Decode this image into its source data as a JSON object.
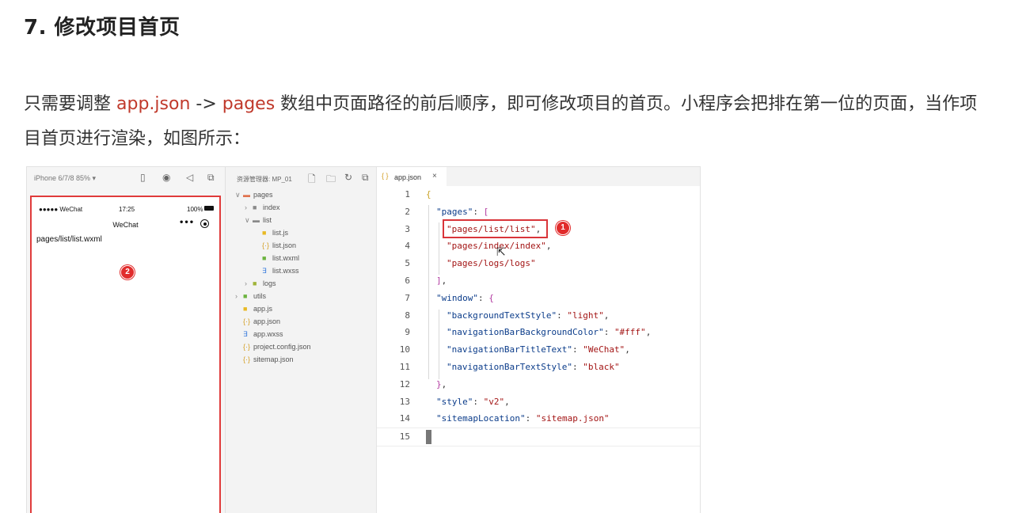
{
  "heading": "7. 修改项目首页",
  "paragraph": {
    "part1": "只需要调整 ",
    "code1": "app.json",
    "part2": " -> ",
    "code2": "pages",
    "part3": " 数组中页面路径的前后顺序，即可修改项目的首页。小程序会把排在第一位的页面，当作项目首页进行渲染，如图所示："
  },
  "colors": {
    "accent_red": "#c0392b",
    "marker_red": "#e12b2b"
  },
  "figure": {
    "simulator": {
      "device_label": "iPhone 6/7/8 85% ▾",
      "toolbar_icons": [
        "phone-icon",
        "record-icon",
        "sound-icon",
        "window-icon"
      ],
      "status_left": "●●●●● WeChat",
      "status_time": "17:25",
      "status_battery": "100%",
      "nav_title": "WeChat",
      "capsule_dots": "•••",
      "page_text": "pages/list/list.wxml",
      "marker": "2"
    },
    "explorer": {
      "header": "资源管理器: MP_01",
      "toolbar_icons": [
        "new-file-icon",
        "new-folder-icon",
        "refresh-icon",
        "collapse-icon"
      ],
      "tree": [
        {
          "label": "pages",
          "type": "folder-open",
          "chev": "∨",
          "level": 0
        },
        {
          "label": "index",
          "type": "folder",
          "chev": "›",
          "level": 1
        },
        {
          "label": "list",
          "type": "folder-open",
          "chev": "∨",
          "level": 1
        },
        {
          "label": "list.js",
          "type": "js",
          "chev": "",
          "level": 2
        },
        {
          "label": "list.json",
          "type": "json",
          "chev": "",
          "level": 2
        },
        {
          "label": "list.wxml",
          "type": "wxml",
          "chev": "",
          "level": 2
        },
        {
          "label": "list.wxss",
          "type": "wxss",
          "chev": "",
          "level": 2
        },
        {
          "label": "logs",
          "type": "folder",
          "chev": "›",
          "level": 1
        },
        {
          "label": "utils",
          "type": "folder",
          "chev": "›",
          "level": 0
        },
        {
          "label": "app.js",
          "type": "js",
          "chev": "",
          "level": 0
        },
        {
          "label": "app.json",
          "type": "json",
          "chev": "",
          "level": 0
        },
        {
          "label": "app.wxss",
          "type": "wxss",
          "chev": "",
          "level": 0
        },
        {
          "label": "project.config.json",
          "type": "json",
          "chev": "",
          "level": 0
        },
        {
          "label": "sitemap.json",
          "type": "json",
          "chev": "",
          "level": 0
        }
      ]
    },
    "editor": {
      "tab_label": "app.json",
      "tab_icon": "{ }",
      "tab_close": "×",
      "marker": "1",
      "lines": [
        {
          "n": "1",
          "indent": 0,
          "tokens": [
            {
              "t": "{",
              "c": "#c9a227"
            }
          ]
        },
        {
          "n": "2",
          "indent": 1,
          "tokens": [
            {
              "t": "\"pages\"",
              "c": "#0b3c8a"
            },
            {
              "t": ": ",
              "c": "#333333"
            },
            {
              "t": "[",
              "c": "#b23aa0"
            }
          ]
        },
        {
          "n": "3",
          "indent": 2,
          "tokens": [
            {
              "t": "\"pages/list/list\"",
              "c": "#a31515"
            },
            {
              "t": ",",
              "c": "#333333"
            }
          ]
        },
        {
          "n": "4",
          "indent": 2,
          "tokens": [
            {
              "t": "\"pages/index/index\"",
              "c": "#a31515"
            },
            {
              "t": ",",
              "c": "#333333"
            }
          ]
        },
        {
          "n": "5",
          "indent": 2,
          "tokens": [
            {
              "t": "\"pages/logs/logs\"",
              "c": "#a31515"
            }
          ]
        },
        {
          "n": "6",
          "indent": 1,
          "tokens": [
            {
              "t": "]",
              "c": "#b23aa0"
            },
            {
              "t": ",",
              "c": "#333333"
            }
          ]
        },
        {
          "n": "7",
          "indent": 1,
          "tokens": [
            {
              "t": "\"window\"",
              "c": "#0b3c8a"
            },
            {
              "t": ": ",
              "c": "#333333"
            },
            {
              "t": "{",
              "c": "#b23aa0"
            }
          ]
        },
        {
          "n": "8",
          "indent": 2,
          "tokens": [
            {
              "t": "\"backgroundTextStyle\"",
              "c": "#0b3c8a"
            },
            {
              "t": ": ",
              "c": "#333333"
            },
            {
              "t": "\"light\"",
              "c": "#a31515"
            },
            {
              "t": ",",
              "c": "#333333"
            }
          ]
        },
        {
          "n": "9",
          "indent": 2,
          "tokens": [
            {
              "t": "\"navigationBarBackgroundColor\"",
              "c": "#0b3c8a"
            },
            {
              "t": ": ",
              "c": "#333333"
            },
            {
              "t": "\"#fff\"",
              "c": "#a31515"
            },
            {
              "t": ",",
              "c": "#333333"
            }
          ]
        },
        {
          "n": "10",
          "indent": 2,
          "tokens": [
            {
              "t": "\"navigationBarTitleText\"",
              "c": "#0b3c8a"
            },
            {
              "t": ": ",
              "c": "#333333"
            },
            {
              "t": "\"WeChat\"",
              "c": "#a31515"
            },
            {
              "t": ",",
              "c": "#333333"
            }
          ]
        },
        {
          "n": "11",
          "indent": 2,
          "tokens": [
            {
              "t": "\"navigationBarTextStyle\"",
              "c": "#0b3c8a"
            },
            {
              "t": ": ",
              "c": "#333333"
            },
            {
              "t": "\"black\"",
              "c": "#a31515"
            }
          ]
        },
        {
          "n": "12",
          "indent": 1,
          "tokens": [
            {
              "t": "}",
              "c": "#b23aa0"
            },
            {
              "t": ",",
              "c": "#333333"
            }
          ]
        },
        {
          "n": "13",
          "indent": 1,
          "tokens": [
            {
              "t": "\"style\"",
              "c": "#0b3c8a"
            },
            {
              "t": ": ",
              "c": "#333333"
            },
            {
              "t": "\"v2\"",
              "c": "#a31515"
            },
            {
              "t": ",",
              "c": "#333333"
            }
          ]
        },
        {
          "n": "14",
          "indent": 1,
          "tokens": [
            {
              "t": "\"sitemapLocation\"",
              "c": "#0b3c8a"
            },
            {
              "t": ": ",
              "c": "#333333"
            },
            {
              "t": "\"sitemap.json\"",
              "c": "#a31515"
            }
          ]
        },
        {
          "n": "15",
          "indent": 0,
          "tokens": [
            {
              "t": "}",
              "c": "#c9a227"
            }
          ]
        }
      ]
    }
  }
}
